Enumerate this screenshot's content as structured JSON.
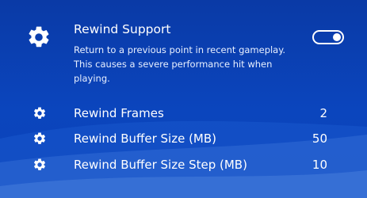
{
  "background": {
    "color": "#0b45bd"
  },
  "rewind_support": {
    "icon": "gear-icon",
    "title": "Rewind Support",
    "description": "Return to a previous point in recent gameplay.\nThis causes a severe performance hit when\nplaying.",
    "toggle_on": true
  },
  "settings": [
    {
      "icon": "gear-icon",
      "label": "Rewind Frames",
      "value": "2"
    },
    {
      "icon": "gear-icon",
      "label": "Rewind Buffer Size (MB)",
      "value": "50"
    },
    {
      "icon": "gear-icon",
      "label": "Rewind Buffer Size Step (MB)",
      "value": "10"
    }
  ]
}
